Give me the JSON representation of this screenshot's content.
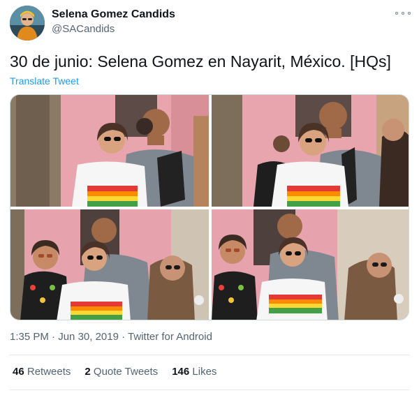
{
  "author": {
    "name": "Selena Gomez Candids",
    "handle": "@SACandids"
  },
  "tweet": {
    "text": "30 de junio: Selena Gomez en Nayarit, México. [HQs]",
    "translate_label": "Translate Tweet"
  },
  "media": {
    "photo_count": 4,
    "photos": [
      {
        "icon": "photo-1"
      },
      {
        "icon": "photo-2"
      },
      {
        "icon": "photo-3"
      },
      {
        "icon": "photo-4"
      }
    ]
  },
  "meta": {
    "time": "1:35 PM",
    "separator": "·",
    "date": "Jun 30, 2019",
    "source": "Twitter for Android"
  },
  "stats": {
    "retweets_count": "46",
    "retweets_label": "Retweets",
    "quotes_count": "2",
    "quotes_label": "Quote Tweets",
    "likes_count": "146",
    "likes_label": "Likes"
  },
  "colors": {
    "link": "#1d9bf0",
    "secondary_text": "#536471",
    "primary_text": "#0f1419",
    "divider": "#e4e9ec"
  }
}
